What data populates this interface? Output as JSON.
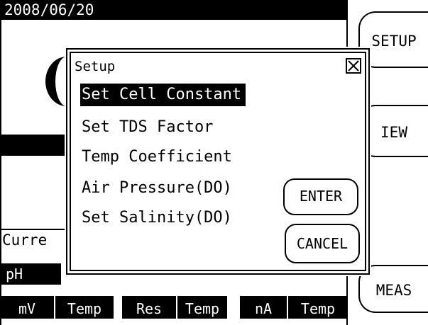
{
  "screen": {
    "date": "2008/06/20",
    "current_label": "Curre",
    "ph_tab": "pH",
    "cells": [
      "mV",
      "Temp",
      "Res",
      "Temp",
      "nA",
      "Temp"
    ]
  },
  "side_buttons": {
    "setup": "SETUP",
    "view": "IEW",
    "meas": "MEAS"
  },
  "dialog": {
    "title": "Setup",
    "items": [
      {
        "label": "Set Cell Constant",
        "selected": true
      },
      {
        "label": "Set TDS Factor",
        "selected": false
      },
      {
        "label": "Temp Coefficient",
        "selected": false
      },
      {
        "label": "Air Pressure(DO)",
        "selected": false
      },
      {
        "label": "Set Salinity(DO)",
        "selected": false
      }
    ],
    "enter_label": "ENTER",
    "cancel_label": "CANCEL"
  },
  "colors": {
    "foreground": "#000000",
    "background": "#ffffff"
  }
}
